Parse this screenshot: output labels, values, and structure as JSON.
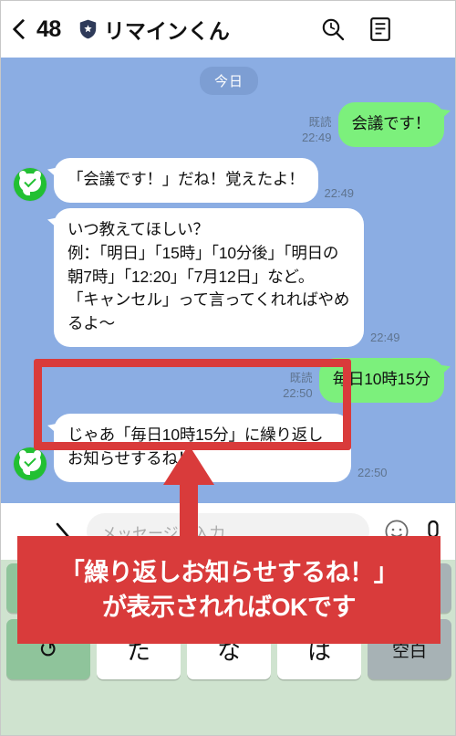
{
  "header": {
    "back_count": "48",
    "badge_icon": "shield-verified-icon",
    "title": "リマインくん",
    "search_icon": "search-icon",
    "notes_icon": "note-list-icon",
    "menu_icon": "hamburger-menu-icon"
  },
  "chat": {
    "date_divider": "今日",
    "messages": [
      {
        "side": "out",
        "text": "会議です！",
        "read": "既読",
        "time": "22:49"
      },
      {
        "side": "in",
        "text": "「会議です！」だね！覚えたよ！",
        "time": "22:49"
      },
      {
        "side": "in",
        "text": "いつ教えてほしい？\n例：「明日」「15時」「10分後」「明日の朝7時」「12:20」「7月12日」など。\n「キャンセル」って言ってくれればやめるよ〜",
        "time": "22:49"
      },
      {
        "side": "out",
        "text": "毎日10時15分",
        "read": "既読",
        "time": "22:50"
      },
      {
        "side": "in",
        "text": "じゃあ「毎日10時15分」に繰り返しお知らせするね！",
        "time": "22:50"
      }
    ]
  },
  "input_bar": {
    "menu_icon": "hamburger-menu-icon",
    "slash_icon": "slash-icon",
    "placeholder": "メッセージを入力",
    "emoji_icon": "emoji-smiley-icon",
    "mic_icon": "microphone-icon"
  },
  "keyboard": {
    "keys": [
      {
        "label": "↺",
        "name": "undo-key",
        "style": "green"
      },
      {
        "label": "た",
        "name": "ta-key",
        "style": "white"
      },
      {
        "label": "な",
        "name": "na-key",
        "style": "white"
      },
      {
        "label": "は",
        "name": "ha-key",
        "style": "white"
      },
      {
        "label": "空白",
        "name": "space-key",
        "style": "gray"
      }
    ]
  },
  "annotation": {
    "highlight_target": "bot-confirmation-message",
    "banner_line1": "「繰り返しお知らせするね！」",
    "banner_line2": "が表示されればOKです",
    "accent_color": "#d93b3b"
  },
  "colors": {
    "chat_background": "#8badE3",
    "outgoing_bubble": "#7cf07c",
    "incoming_bubble": "#ffffff",
    "avatar_green": "#22c032",
    "keyboard_background": "#cfe3cf"
  }
}
